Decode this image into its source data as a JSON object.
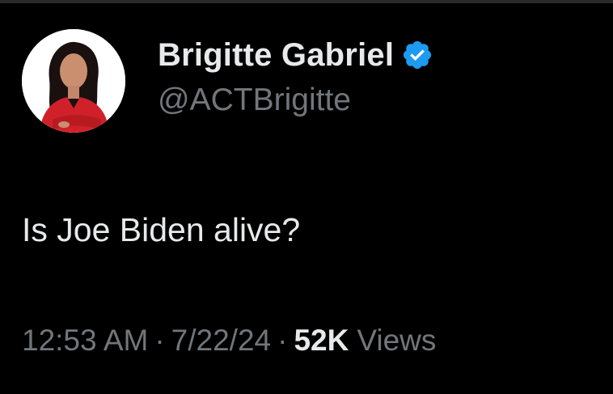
{
  "tweet": {
    "author": {
      "display_name": "Brigitte Gabriel",
      "handle": "@ACTBrigitte",
      "verified_icon": "verified-badge-icon",
      "avatar_icon": "profile-photo"
    },
    "text": "Is Joe Biden alive?",
    "meta": {
      "time": "12:53 AM",
      "separator": "·",
      "date": "7/22/24",
      "views_count": "52K",
      "views_label": "Views"
    }
  },
  "colors": {
    "background": "#000000",
    "primary_text": "#e7e9ea",
    "secondary_text": "#71767b",
    "verified_blue": "#1d9bf0"
  }
}
